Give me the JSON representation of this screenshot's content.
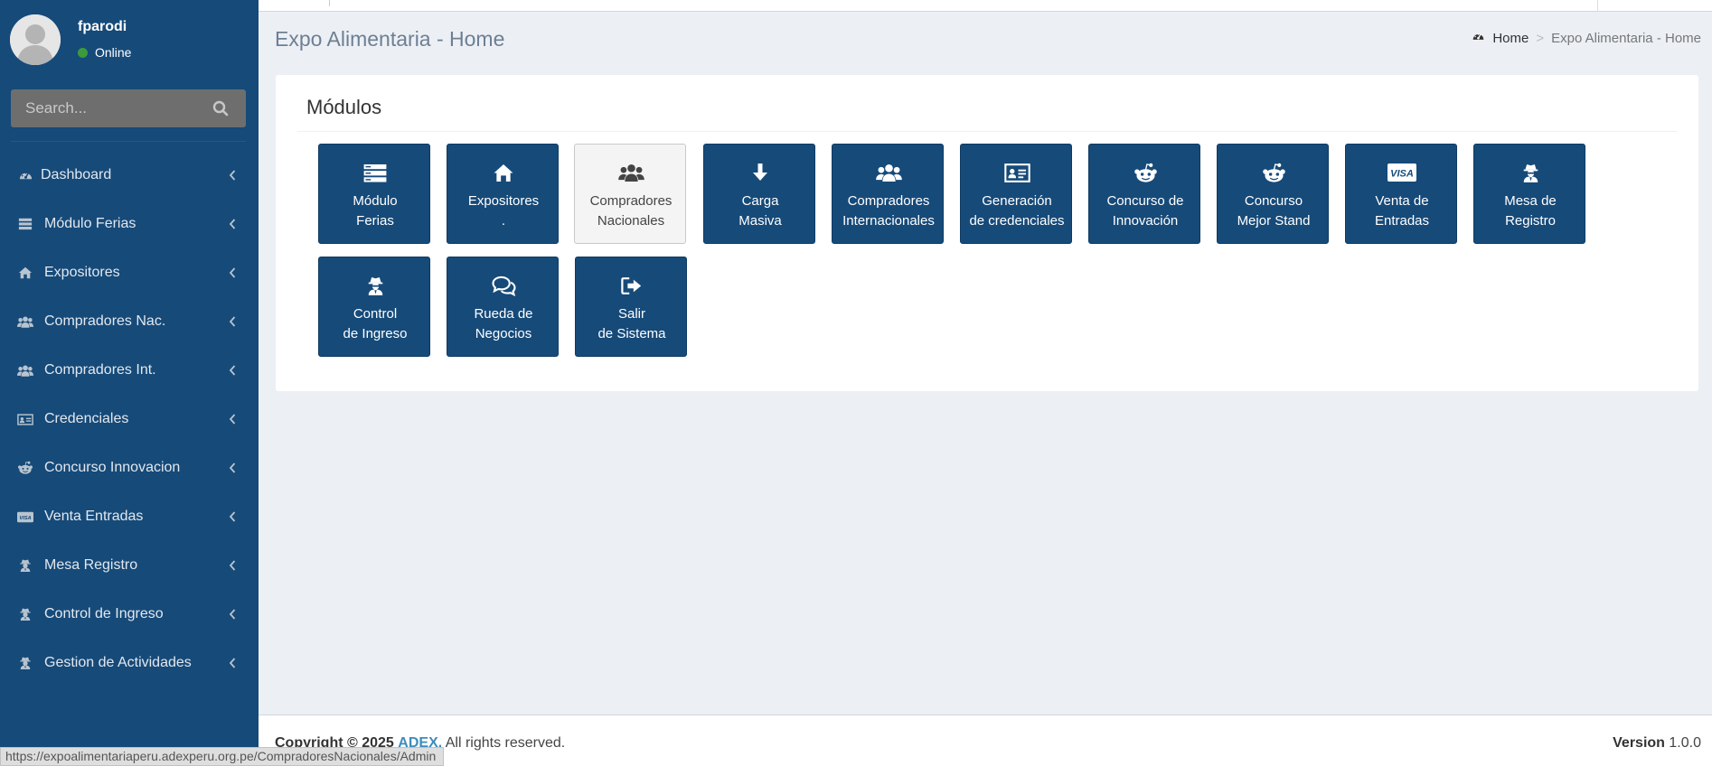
{
  "user": {
    "name": "fparodi",
    "status": "Online"
  },
  "search": {
    "placeholder": "Search..."
  },
  "sidebar": {
    "items": [
      {
        "label": "Dashboard",
        "icon": "dashboard-icon"
      },
      {
        "label": "Módulo Ferias",
        "icon": "server-icon"
      },
      {
        "label": "Expositores",
        "icon": "home-icon"
      },
      {
        "label": "Compradores Nac.",
        "icon": "users-icon"
      },
      {
        "label": "Compradores Int.",
        "icon": "users-icon"
      },
      {
        "label": "Credenciales",
        "icon": "id-card-icon"
      },
      {
        "label": "Concurso Innovacion",
        "icon": "reddit-icon"
      },
      {
        "label": "Venta Entradas",
        "icon": "visa-icon"
      },
      {
        "label": "Mesa Registro",
        "icon": "user-secret-icon"
      },
      {
        "label": "Control de Ingreso",
        "icon": "user-secret-icon"
      },
      {
        "label": "Gestion de Actividades",
        "icon": "user-secret-icon"
      }
    ]
  },
  "header": {
    "title": "Expo Alimentaria - Home"
  },
  "breadcrumb": {
    "home": "Home",
    "current": "Expo Alimentaria - Home"
  },
  "modules": {
    "title": "Módulos",
    "tiles": [
      {
        "line1": "Módulo",
        "line2": "Ferias",
        "icon": "server-icon"
      },
      {
        "line1": "Expositores",
        "line2": ".",
        "icon": "home-icon"
      },
      {
        "line1": "Compradores",
        "line2": "Nacionales",
        "icon": "users-icon"
      },
      {
        "line1": "Carga",
        "line2": "Masiva",
        "icon": "arrow-down-icon"
      },
      {
        "line1": "Compradores",
        "line2": "Internacionales",
        "icon": "users-icon"
      },
      {
        "line1": "Generación",
        "line2": "de credenciales",
        "icon": "id-card-icon"
      },
      {
        "line1": "Concurso de",
        "line2": "Innovación",
        "icon": "reddit-icon"
      },
      {
        "line1": "Concurso",
        "line2": "Mejor Stand",
        "icon": "reddit-icon"
      },
      {
        "line1": "Venta de",
        "line2": "Entradas",
        "icon": "visa-icon"
      },
      {
        "line1": "Mesa de",
        "line2": "Registro",
        "icon": "user-secret-icon"
      },
      {
        "line1": "Control",
        "line2": "de Ingreso",
        "icon": "user-secret-icon"
      },
      {
        "line1": "Rueda de",
        "line2": "Negocios",
        "icon": "comments-icon"
      },
      {
        "line1": "Salir",
        "line2": "de Sistema",
        "icon": "sign-out-icon"
      }
    ]
  },
  "footer": {
    "copyright_prefix": "Copyright © 2025",
    "brand": "ADEX.",
    "rights": "All rights reserved.",
    "version_label": "Version",
    "version": "1.0.0"
  },
  "statusbar": {
    "url": "https://expoalimentariaperu.adexperu.org.pe/CompradoresNacionales/Admin"
  },
  "colors": {
    "sidebar": "#164a79",
    "tile": "#164a79",
    "content_bg": "#ecf0f5",
    "online": "#3c9a3c",
    "brand_link": "#3c8dbc"
  }
}
